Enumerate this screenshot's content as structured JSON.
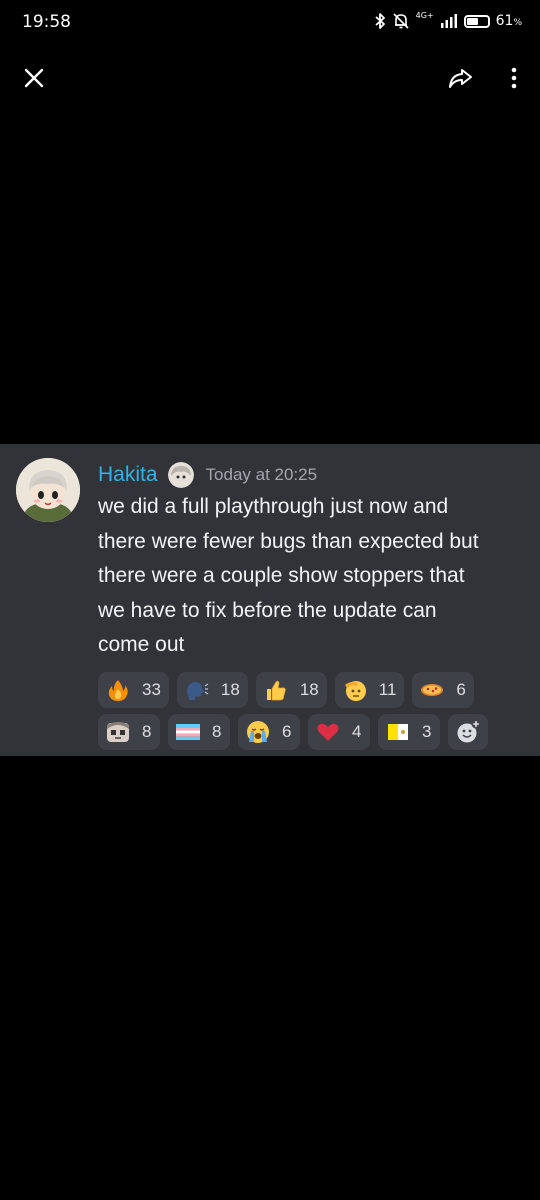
{
  "status_bar": {
    "time": "19:58",
    "network_label": "4G+",
    "battery_percent": "61",
    "battery_unit": "%",
    "battery_level": 0.61
  },
  "toolbar": {
    "close_icon": "close-icon",
    "share_icon": "share-icon",
    "more_icon": "more-vert-icon"
  },
  "message": {
    "username": "Hakita",
    "timestamp": "Today at 20:25",
    "lines": [
      "we did a full playthrough just now and",
      "there were fewer bugs than expected but",
      "there were a couple show stoppers that",
      "we have to fix before the update can",
      "come out"
    ],
    "username_color": "#2cb4ea",
    "card_color": "#323339"
  },
  "reactions": [
    {
      "icon": "fire-emoji-icon",
      "count": "33"
    },
    {
      "icon": "speaking-head-emoji-icon",
      "count": "18"
    },
    {
      "icon": "thumbs-up-emoji-icon",
      "count": "18"
    },
    {
      "icon": "saluting-face-emoji-icon",
      "count": "11"
    },
    {
      "icon": "pizza-emoji-icon",
      "count": "6"
    },
    {
      "icon": "custom-face-emoji-icon",
      "count": "8"
    },
    {
      "icon": "transgender-flag-emoji-icon",
      "count": "8"
    },
    {
      "icon": "loudly-crying-face-emoji-icon",
      "count": "6"
    },
    {
      "icon": "red-heart-emoji-icon",
      "count": "4"
    },
    {
      "icon": "vatican-flag-emoji-icon",
      "count": "3"
    }
  ],
  "add_reaction_icon": "add-reaction-icon"
}
